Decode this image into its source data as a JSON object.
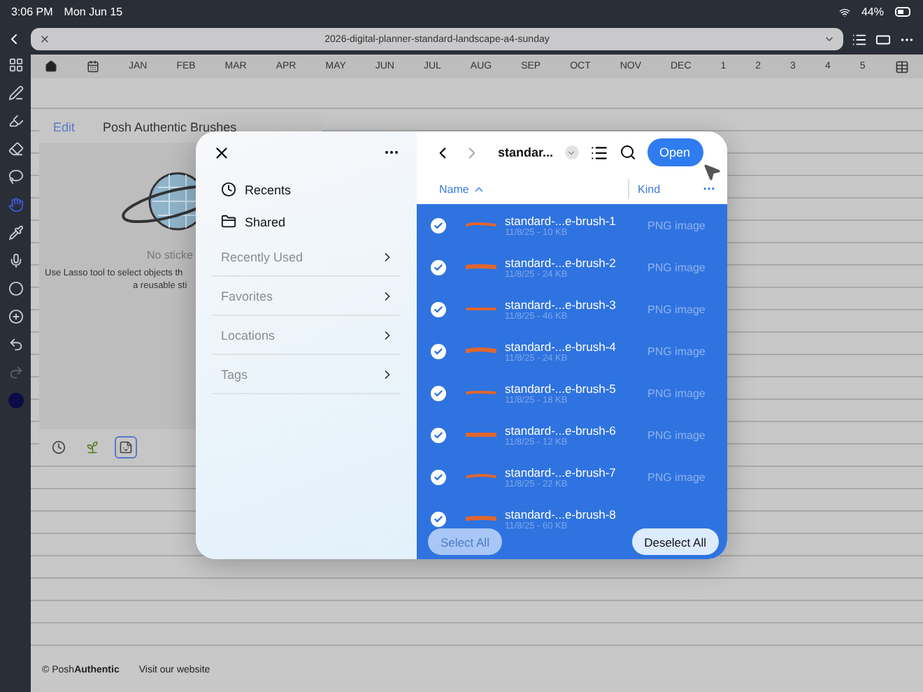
{
  "status_bar": {
    "time": "3:06 PM",
    "date": "Mon Jun 15",
    "battery": "44%"
  },
  "document_bar": {
    "title": "2026-digital-planner-standard-landscape-a4-sunday"
  },
  "tools": [
    {
      "kind": "grid",
      "selected": false,
      "disabled": false
    },
    {
      "kind": "pen",
      "selected": false,
      "disabled": false
    },
    {
      "kind": "highlighter",
      "selected": false,
      "disabled": false
    },
    {
      "kind": "eraser",
      "selected": false,
      "disabled": false
    },
    {
      "kind": "lasso",
      "selected": false,
      "disabled": false
    },
    {
      "kind": "hand",
      "selected": true,
      "disabled": false
    },
    {
      "kind": "pipette",
      "selected": false,
      "disabled": false
    },
    {
      "kind": "mic",
      "selected": false,
      "disabled": false
    },
    {
      "kind": "shape",
      "selected": false,
      "disabled": false
    },
    {
      "kind": "add",
      "selected": false,
      "disabled": false
    },
    {
      "kind": "undo",
      "selected": false,
      "disabled": false
    },
    {
      "kind": "redo",
      "selected": false,
      "disabled": true
    },
    {
      "kind": "swatch",
      "selected": false,
      "disabled": false,
      "color": "#0b0b45"
    }
  ],
  "nav": {
    "items": [
      {
        "kind": "home"
      },
      {
        "kind": "calendar"
      },
      {
        "kind": "text",
        "label": "JAN"
      },
      {
        "kind": "text",
        "label": "FEB"
      },
      {
        "kind": "text",
        "label": "MAR"
      },
      {
        "kind": "text",
        "label": "APR"
      },
      {
        "kind": "text",
        "label": "MAY"
      },
      {
        "kind": "text",
        "label": "JUN"
      },
      {
        "kind": "text",
        "label": "JUL"
      },
      {
        "kind": "text",
        "label": "AUG"
      },
      {
        "kind": "text",
        "label": "SEP"
      },
      {
        "kind": "text",
        "label": "OCT"
      },
      {
        "kind": "text",
        "label": "NOV"
      },
      {
        "kind": "text",
        "label": "DEC"
      },
      {
        "kind": "text",
        "label": "1"
      },
      {
        "kind": "text",
        "label": "2"
      },
      {
        "kind": "text",
        "label": "3"
      },
      {
        "kind": "text",
        "label": "4"
      },
      {
        "kind": "text",
        "label": "5"
      },
      {
        "kind": "table"
      }
    ]
  },
  "sticker_panel": {
    "edit": "Edit",
    "title": "Posh Authentic Brushes",
    "empty_title": "No sticke",
    "hint": [
      "Use Lasso tool to select objects th",
      "a reusable sti"
    ],
    "tabs": [
      {
        "kind": "recent",
        "selected": false
      },
      {
        "kind": "plant",
        "selected": false
      },
      {
        "kind": "sticker",
        "selected": true
      }
    ]
  },
  "picker": {
    "sidebar": {
      "items": [
        "Recents",
        "Shared"
      ],
      "sections": [
        "Recently Used",
        "Favorites",
        "Locations",
        "Tags"
      ]
    },
    "toolbar": {
      "folder": "standar...",
      "open": "Open"
    },
    "columns": {
      "name": "Name",
      "kind": "Kind"
    },
    "files": [
      {
        "name": "standard-...e-brush-1",
        "meta": "11/8/25 - 10 KB",
        "kind": "PNG image",
        "selected": true
      },
      {
        "name": "standard-...e-brush-2",
        "meta": "11/8/25 - 24 KB",
        "kind": "PNG image",
        "selected": true
      },
      {
        "name": "standard-...e-brush-3",
        "meta": "11/8/25 - 46 KB",
        "kind": "PNG image",
        "selected": true
      },
      {
        "name": "standard-...e-brush-4",
        "meta": "11/8/25 - 24 KB",
        "kind": "PNG image",
        "selected": true
      },
      {
        "name": "standard-...e-brush-5",
        "meta": "11/8/25 - 18 KB",
        "kind": "PNG image",
        "selected": true
      },
      {
        "name": "standard-...e-brush-6",
        "meta": "11/8/25 - 12 KB",
        "kind": "PNG image",
        "selected": true
      },
      {
        "name": "standard-...e-brush-7",
        "meta": "11/8/25 - 22 KB",
        "kind": "PNG image",
        "selected": true
      },
      {
        "name": "standard-...e-brush-8",
        "meta": "11/8/25 - 60 KB",
        "selected": true
      }
    ],
    "select_all": {
      "label": "Select All",
      "disabled": true
    },
    "deselect_all": {
      "label": "Deselect All",
      "disabled": false
    }
  },
  "footer": {
    "brand": "© Posh**Authentic**",
    "link": "Visit our website"
  }
}
